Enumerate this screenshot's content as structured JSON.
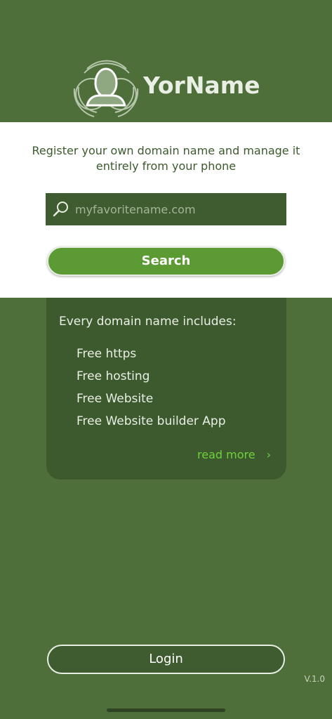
{
  "brand": {
    "name": "YorName",
    "logo_icon": "avatar-rings-icon"
  },
  "search": {
    "tagline": "Register your own domain name and manage it entirely from your phone",
    "placeholder": "myfavoritename.com",
    "value": "",
    "button_label": "Search",
    "icon": "search-icon"
  },
  "info": {
    "heading": "Every domain name includes:",
    "features": [
      "Free https",
      "Free hosting",
      "Free Website",
      "Free Website builder App"
    ],
    "read_more_label": "read more",
    "read_more_icon": "chevron-right-icon"
  },
  "login": {
    "label": "Login"
  },
  "version": "V.1.0",
  "colors": {
    "background": "#4e6e3a",
    "card": "#3d5a2f",
    "accent": "#5c9a33",
    "link": "#6fd13a"
  }
}
